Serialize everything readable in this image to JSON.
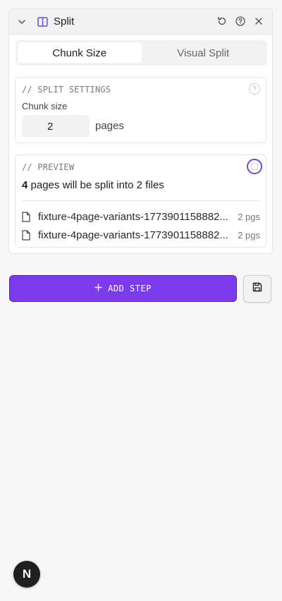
{
  "header": {
    "title": "Split"
  },
  "tabs": [
    {
      "label": "Chunk Size",
      "active": true
    },
    {
      "label": "Visual Split",
      "active": false
    }
  ],
  "settings": {
    "section_label": "// SPLIT SETTINGS",
    "help_text": "?",
    "chunk_label": "Chunk size",
    "chunk_value": "2",
    "chunk_unit": "pages"
  },
  "preview": {
    "section_label": "// PREVIEW",
    "total_pages": "4",
    "summary_middle": " pages will be split into ",
    "file_count": "2",
    "summary_end": " files",
    "files": [
      {
        "name": "fixture-4page-variants-1773901158882...",
        "pages": "2 pgs"
      },
      {
        "name": "fixture-4page-variants-1773901158882...",
        "pages": "2 pgs"
      }
    ]
  },
  "actions": {
    "add_step_label": "ADD STEP"
  },
  "badge": {
    "letter": "N"
  },
  "colors": {
    "accent": "#7c3aed",
    "accent_border": "#5b21b6",
    "panel_bg": "#ffffff",
    "page_bg": "#f7f7f7"
  },
  "icons": [
    "chevron-down-icon",
    "split-icon",
    "reset-icon",
    "help-icon",
    "close-icon",
    "file-icon",
    "plus-icon",
    "save-icon"
  ]
}
